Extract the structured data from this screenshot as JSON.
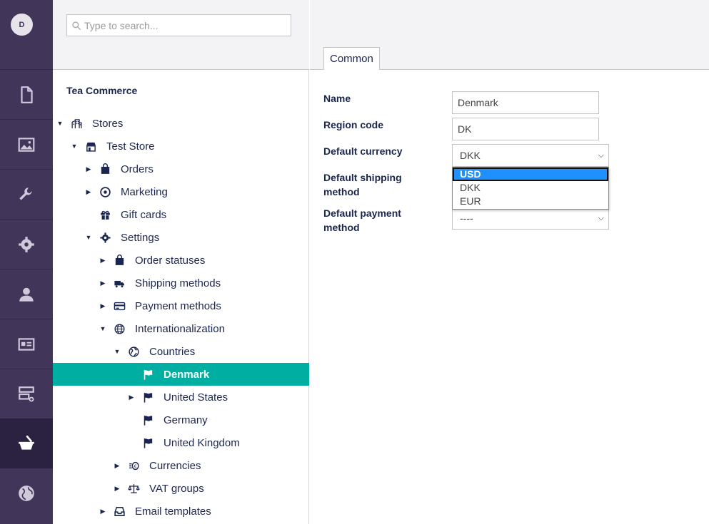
{
  "user": {
    "avatar_initial": "D"
  },
  "rail": {
    "items": [
      {
        "name": "content-icon",
        "active": false
      },
      {
        "name": "media-icon",
        "active": false
      },
      {
        "name": "settings-wrench-icon",
        "active": false
      },
      {
        "name": "gear-icon",
        "active": false
      },
      {
        "name": "user-icon",
        "active": false
      },
      {
        "name": "members-card-icon",
        "active": false
      },
      {
        "name": "forms-icon",
        "active": false
      },
      {
        "name": "commerce-basket-icon",
        "active": true
      },
      {
        "name": "globe-icon",
        "active": false
      }
    ]
  },
  "tree": {
    "search_placeholder": "Type to search...",
    "title": "Tea Commerce",
    "nodes": [
      {
        "label": "Stores",
        "caret": "down",
        "icon": "stores-building-icon"
      },
      {
        "label": "Test Store",
        "caret": "down",
        "icon": "store-icon"
      },
      {
        "label": "Orders",
        "caret": "right",
        "icon": "orders-bag-icon"
      },
      {
        "label": "Marketing",
        "caret": "right",
        "icon": "marketing-target-icon"
      },
      {
        "label": "Gift cards",
        "caret": "",
        "icon": "gift-icon"
      },
      {
        "label": "Settings",
        "caret": "down",
        "icon": "settings-gear-icon"
      },
      {
        "label": "Order statuses",
        "caret": "right",
        "icon": "order-status-bag-icon"
      },
      {
        "label": "Shipping methods",
        "caret": "right",
        "icon": "truck-icon"
      },
      {
        "label": "Payment methods",
        "caret": "right",
        "icon": "credit-card-icon"
      },
      {
        "label": "Internationalization",
        "caret": "down",
        "icon": "globe-icon"
      },
      {
        "label": "Countries",
        "caret": "down",
        "icon": "earth-icon"
      },
      {
        "label": "Denmark",
        "caret": "",
        "icon": "flag-icon",
        "selected": true
      },
      {
        "label": "United States",
        "caret": "right",
        "icon": "flag-icon"
      },
      {
        "label": "Germany",
        "caret": "",
        "icon": "flag-icon"
      },
      {
        "label": "United Kingdom",
        "caret": "",
        "icon": "flag-icon"
      },
      {
        "label": "Currencies",
        "caret": "right",
        "icon": "coins-icon"
      },
      {
        "label": "VAT groups",
        "caret": "right",
        "icon": "scales-icon"
      },
      {
        "label": "Email templates",
        "caret": "right",
        "icon": "inbox-icon"
      }
    ]
  },
  "editor": {
    "tabs": [
      {
        "label": "Common"
      }
    ],
    "fields": {
      "name": {
        "label": "Name",
        "value": "Denmark"
      },
      "region_code": {
        "label": "Region code",
        "value": "DK"
      },
      "default_currency": {
        "label": "Default currency",
        "value": "DKK",
        "options": [
          "USD",
          "DKK",
          "EUR"
        ],
        "highlighted": "USD"
      },
      "default_shipping_method": {
        "label": "Default shipping method"
      },
      "default_payment_method": {
        "label": "Default payment method",
        "value": "----"
      }
    }
  },
  "colors": {
    "rail_bg": "#413659",
    "selected_bg": "#00aea2",
    "highlight": "#1e90ff"
  }
}
